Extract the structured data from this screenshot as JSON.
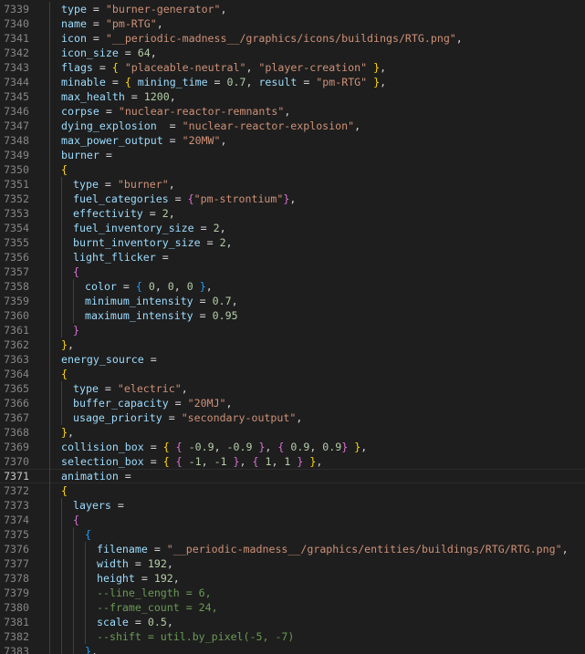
{
  "editor": {
    "current_line": 7371,
    "colors": {
      "background": "#1e1e1e",
      "key": "#9cdcfe",
      "string": "#ce9178",
      "number": "#b5cea8",
      "comment": "#6a9955",
      "bracket1": "#ffd700",
      "bracket2": "#da70d6",
      "bracket3": "#179fff"
    },
    "lines": [
      {
        "num": "7339",
        "indent": 1,
        "tokens": [
          {
            "t": "type",
            "c": "k"
          },
          {
            "t": " = ",
            "c": "o"
          },
          {
            "t": "\"burner-generator\"",
            "c": "s"
          },
          {
            "t": ",",
            "c": "p"
          }
        ]
      },
      {
        "num": "7340",
        "indent": 1,
        "tokens": [
          {
            "t": "name",
            "c": "k"
          },
          {
            "t": " = ",
            "c": "o"
          },
          {
            "t": "\"pm-RTG\"",
            "c": "s"
          },
          {
            "t": ",",
            "c": "p"
          }
        ]
      },
      {
        "num": "7341",
        "indent": 1,
        "tokens": [
          {
            "t": "icon",
            "c": "k"
          },
          {
            "t": " = ",
            "c": "o"
          },
          {
            "t": "\"__periodic-madness__/graphics/icons/buildings/RTG.png\"",
            "c": "s"
          },
          {
            "t": ",",
            "c": "p"
          }
        ]
      },
      {
        "num": "7342",
        "indent": 1,
        "tokens": [
          {
            "t": "icon_size",
            "c": "k"
          },
          {
            "t": " = ",
            "c": "o"
          },
          {
            "t": "64",
            "c": "n"
          },
          {
            "t": ",",
            "c": "p"
          }
        ]
      },
      {
        "num": "7343",
        "indent": 1,
        "tokens": [
          {
            "t": "flags",
            "c": "k"
          },
          {
            "t": " = ",
            "c": "o"
          },
          {
            "t": "{",
            "c": "b1"
          },
          {
            "t": " ",
            "c": "p"
          },
          {
            "t": "\"placeable-neutral\"",
            "c": "s"
          },
          {
            "t": ", ",
            "c": "p"
          },
          {
            "t": "\"player-creation\"",
            "c": "s"
          },
          {
            "t": " ",
            "c": "p"
          },
          {
            "t": "}",
            "c": "b1"
          },
          {
            "t": ",",
            "c": "p"
          }
        ]
      },
      {
        "num": "7344",
        "indent": 1,
        "tokens": [
          {
            "t": "minable",
            "c": "k"
          },
          {
            "t": " = ",
            "c": "o"
          },
          {
            "t": "{",
            "c": "b1"
          },
          {
            "t": " ",
            "c": "p"
          },
          {
            "t": "mining_time",
            "c": "k"
          },
          {
            "t": " = ",
            "c": "o"
          },
          {
            "t": "0.7",
            "c": "n"
          },
          {
            "t": ", ",
            "c": "p"
          },
          {
            "t": "result",
            "c": "k"
          },
          {
            "t": " = ",
            "c": "o"
          },
          {
            "t": "\"pm-RTG\"",
            "c": "s"
          },
          {
            "t": " ",
            "c": "p"
          },
          {
            "t": "}",
            "c": "b1"
          },
          {
            "t": ",",
            "c": "p"
          }
        ]
      },
      {
        "num": "7345",
        "indent": 1,
        "tokens": [
          {
            "t": "max_health",
            "c": "k"
          },
          {
            "t": " = ",
            "c": "o"
          },
          {
            "t": "1200",
            "c": "n"
          },
          {
            "t": ",",
            "c": "p"
          }
        ]
      },
      {
        "num": "7346",
        "indent": 1,
        "tokens": [
          {
            "t": "corpse",
            "c": "k"
          },
          {
            "t": " = ",
            "c": "o"
          },
          {
            "t": "\"nuclear-reactor-remnants\"",
            "c": "s"
          },
          {
            "t": ",",
            "c": "p"
          }
        ]
      },
      {
        "num": "7347",
        "indent": 1,
        "tokens": [
          {
            "t": "dying_explosion",
            "c": "k"
          },
          {
            "t": "  = ",
            "c": "o"
          },
          {
            "t": "\"nuclear-reactor-explosion\"",
            "c": "s"
          },
          {
            "t": ",",
            "c": "p"
          }
        ]
      },
      {
        "num": "7348",
        "indent": 1,
        "tokens": [
          {
            "t": "max_power_output",
            "c": "k"
          },
          {
            "t": " = ",
            "c": "o"
          },
          {
            "t": "\"20MW\"",
            "c": "s"
          },
          {
            "t": ",",
            "c": "p"
          }
        ]
      },
      {
        "num": "7349",
        "indent": 1,
        "tokens": [
          {
            "t": "burner",
            "c": "k"
          },
          {
            "t": " =",
            "c": "o"
          }
        ]
      },
      {
        "num": "7350",
        "indent": 1,
        "tokens": [
          {
            "t": "{",
            "c": "b1"
          }
        ]
      },
      {
        "num": "7351",
        "indent": 2,
        "tokens": [
          {
            "t": "type",
            "c": "k"
          },
          {
            "t": " = ",
            "c": "o"
          },
          {
            "t": "\"burner\"",
            "c": "s"
          },
          {
            "t": ",",
            "c": "p"
          }
        ]
      },
      {
        "num": "7352",
        "indent": 2,
        "tokens": [
          {
            "t": "fuel_categories",
            "c": "k"
          },
          {
            "t": " = ",
            "c": "o"
          },
          {
            "t": "{",
            "c": "b2"
          },
          {
            "t": "\"pm-strontium\"",
            "c": "s"
          },
          {
            "t": "}",
            "c": "b2"
          },
          {
            "t": ",",
            "c": "p"
          }
        ]
      },
      {
        "num": "7353",
        "indent": 2,
        "tokens": [
          {
            "t": "effectivity",
            "c": "k"
          },
          {
            "t": " = ",
            "c": "o"
          },
          {
            "t": "2",
            "c": "n"
          },
          {
            "t": ",",
            "c": "p"
          }
        ]
      },
      {
        "num": "7354",
        "indent": 2,
        "tokens": [
          {
            "t": "fuel_inventory_size",
            "c": "k"
          },
          {
            "t": " = ",
            "c": "o"
          },
          {
            "t": "2",
            "c": "n"
          },
          {
            "t": ",",
            "c": "p"
          }
        ]
      },
      {
        "num": "7355",
        "indent": 2,
        "tokens": [
          {
            "t": "burnt_inventory_size",
            "c": "k"
          },
          {
            "t": " = ",
            "c": "o"
          },
          {
            "t": "2",
            "c": "n"
          },
          {
            "t": ",",
            "c": "p"
          }
        ]
      },
      {
        "num": "7356",
        "indent": 2,
        "tokens": [
          {
            "t": "light_flicker",
            "c": "k"
          },
          {
            "t": " =",
            "c": "o"
          }
        ]
      },
      {
        "num": "7357",
        "indent": 2,
        "tokens": [
          {
            "t": "{",
            "c": "b2"
          }
        ]
      },
      {
        "num": "7358",
        "indent": 3,
        "tokens": [
          {
            "t": "color",
            "c": "k"
          },
          {
            "t": " = ",
            "c": "o"
          },
          {
            "t": "{",
            "c": "b3"
          },
          {
            "t": " ",
            "c": "p"
          },
          {
            "t": "0",
            "c": "n"
          },
          {
            "t": ", ",
            "c": "p"
          },
          {
            "t": "0",
            "c": "n"
          },
          {
            "t": ", ",
            "c": "p"
          },
          {
            "t": "0",
            "c": "n"
          },
          {
            "t": " ",
            "c": "p"
          },
          {
            "t": "}",
            "c": "b3"
          },
          {
            "t": ",",
            "c": "p"
          }
        ]
      },
      {
        "num": "7359",
        "indent": 3,
        "tokens": [
          {
            "t": "minimum_intensity",
            "c": "k"
          },
          {
            "t": " = ",
            "c": "o"
          },
          {
            "t": "0.7",
            "c": "n"
          },
          {
            "t": ",",
            "c": "p"
          }
        ]
      },
      {
        "num": "7360",
        "indent": 3,
        "tokens": [
          {
            "t": "maximum_intensity",
            "c": "k"
          },
          {
            "t": " = ",
            "c": "o"
          },
          {
            "t": "0.95",
            "c": "n"
          }
        ]
      },
      {
        "num": "7361",
        "indent": 2,
        "tokens": [
          {
            "t": "}",
            "c": "b2"
          }
        ]
      },
      {
        "num": "7362",
        "indent": 1,
        "tokens": [
          {
            "t": "}",
            "c": "b1"
          },
          {
            "t": ",",
            "c": "p"
          }
        ]
      },
      {
        "num": "7363",
        "indent": 1,
        "tokens": [
          {
            "t": "energy_source",
            "c": "k"
          },
          {
            "t": " = ",
            "c": "o"
          }
        ]
      },
      {
        "num": "7364",
        "indent": 1,
        "tokens": [
          {
            "t": "{",
            "c": "b1"
          }
        ]
      },
      {
        "num": "7365",
        "indent": 2,
        "tokens": [
          {
            "t": "type",
            "c": "k"
          },
          {
            "t": " = ",
            "c": "o"
          },
          {
            "t": "\"electric\"",
            "c": "s"
          },
          {
            "t": ",",
            "c": "p"
          }
        ]
      },
      {
        "num": "7366",
        "indent": 2,
        "tokens": [
          {
            "t": "buffer_capacity",
            "c": "k"
          },
          {
            "t": " = ",
            "c": "o"
          },
          {
            "t": "\"20MJ\"",
            "c": "s"
          },
          {
            "t": ",",
            "c": "p"
          }
        ]
      },
      {
        "num": "7367",
        "indent": 2,
        "tokens": [
          {
            "t": "usage_priority",
            "c": "k"
          },
          {
            "t": " = ",
            "c": "o"
          },
          {
            "t": "\"secondary-output\"",
            "c": "s"
          },
          {
            "t": ",",
            "c": "p"
          }
        ]
      },
      {
        "num": "7368",
        "indent": 1,
        "tokens": [
          {
            "t": "}",
            "c": "b1"
          },
          {
            "t": ",",
            "c": "p"
          }
        ]
      },
      {
        "num": "7369",
        "indent": 1,
        "tokens": [
          {
            "t": "collision_box",
            "c": "k"
          },
          {
            "t": " = ",
            "c": "o"
          },
          {
            "t": "{",
            "c": "b1"
          },
          {
            "t": " ",
            "c": "p"
          },
          {
            "t": "{",
            "c": "b2"
          },
          {
            "t": " ",
            "c": "p"
          },
          {
            "t": "-0.9",
            "c": "n"
          },
          {
            "t": ", ",
            "c": "p"
          },
          {
            "t": "-0.9",
            "c": "n"
          },
          {
            "t": " ",
            "c": "p"
          },
          {
            "t": "}",
            "c": "b2"
          },
          {
            "t": ", ",
            "c": "p"
          },
          {
            "t": "{",
            "c": "b2"
          },
          {
            "t": " ",
            "c": "p"
          },
          {
            "t": "0.9",
            "c": "n"
          },
          {
            "t": ", ",
            "c": "p"
          },
          {
            "t": "0.9",
            "c": "n"
          },
          {
            "t": "}",
            "c": "b2"
          },
          {
            "t": " ",
            "c": "p"
          },
          {
            "t": "}",
            "c": "b1"
          },
          {
            "t": ",",
            "c": "p"
          }
        ]
      },
      {
        "num": "7370",
        "indent": 1,
        "tokens": [
          {
            "t": "selection_box",
            "c": "k"
          },
          {
            "t": " = ",
            "c": "o"
          },
          {
            "t": "{",
            "c": "b1"
          },
          {
            "t": " ",
            "c": "p"
          },
          {
            "t": "{",
            "c": "b2"
          },
          {
            "t": " ",
            "c": "p"
          },
          {
            "t": "-1",
            "c": "n"
          },
          {
            "t": ", ",
            "c": "p"
          },
          {
            "t": "-1",
            "c": "n"
          },
          {
            "t": " ",
            "c": "p"
          },
          {
            "t": "}",
            "c": "b2"
          },
          {
            "t": ", ",
            "c": "p"
          },
          {
            "t": "{",
            "c": "b2"
          },
          {
            "t": " ",
            "c": "p"
          },
          {
            "t": "1",
            "c": "n"
          },
          {
            "t": ", ",
            "c": "p"
          },
          {
            "t": "1",
            "c": "n"
          },
          {
            "t": " ",
            "c": "p"
          },
          {
            "t": "}",
            "c": "b2"
          },
          {
            "t": " ",
            "c": "p"
          },
          {
            "t": "}",
            "c": "b1"
          },
          {
            "t": ",",
            "c": "p"
          }
        ]
      },
      {
        "num": "7371",
        "indent": 1,
        "tokens": [
          {
            "t": "animation",
            "c": "k"
          },
          {
            "t": " =",
            "c": "o"
          }
        ]
      },
      {
        "num": "7372",
        "indent": 1,
        "tokens": [
          {
            "t": "{",
            "c": "b1"
          }
        ]
      },
      {
        "num": "7373",
        "indent": 2,
        "tokens": [
          {
            "t": "layers",
            "c": "k"
          },
          {
            "t": " =",
            "c": "o"
          }
        ]
      },
      {
        "num": "7374",
        "indent": 2,
        "tokens": [
          {
            "t": "{",
            "c": "b2"
          }
        ]
      },
      {
        "num": "7375",
        "indent": 3,
        "tokens": [
          {
            "t": "{",
            "c": "b3"
          }
        ]
      },
      {
        "num": "7376",
        "indent": 4,
        "tokens": [
          {
            "t": "filename",
            "c": "k"
          },
          {
            "t": " = ",
            "c": "o"
          },
          {
            "t": "\"__periodic-madness__/graphics/entities/buildings/RTG/RTG.png\"",
            "c": "s"
          },
          {
            "t": ",",
            "c": "p"
          }
        ]
      },
      {
        "num": "7377",
        "indent": 4,
        "tokens": [
          {
            "t": "width",
            "c": "k"
          },
          {
            "t": " = ",
            "c": "o"
          },
          {
            "t": "192",
            "c": "n"
          },
          {
            "t": ",",
            "c": "p"
          }
        ]
      },
      {
        "num": "7378",
        "indent": 4,
        "tokens": [
          {
            "t": "height",
            "c": "k"
          },
          {
            "t": " = ",
            "c": "o"
          },
          {
            "t": "192",
            "c": "n"
          },
          {
            "t": ",",
            "c": "p"
          }
        ]
      },
      {
        "num": "7379",
        "indent": 4,
        "tokens": [
          {
            "t": "--line_length = 6,",
            "c": "c"
          }
        ]
      },
      {
        "num": "7380",
        "indent": 4,
        "tokens": [
          {
            "t": "--frame_count = 24,",
            "c": "c"
          }
        ]
      },
      {
        "num": "7381",
        "indent": 4,
        "tokens": [
          {
            "t": "scale",
            "c": "k"
          },
          {
            "t": " = ",
            "c": "o"
          },
          {
            "t": "0.5",
            "c": "n"
          },
          {
            "t": ",",
            "c": "p"
          }
        ]
      },
      {
        "num": "7382",
        "indent": 4,
        "tokens": [
          {
            "t": "--shift = util.by_pixel(-5, -7)",
            "c": "c"
          }
        ]
      },
      {
        "num": "7383",
        "indent": 3,
        "tokens": [
          {
            "t": "}",
            "c": "b3"
          },
          {
            "t": ",",
            "c": "p"
          }
        ]
      }
    ]
  }
}
